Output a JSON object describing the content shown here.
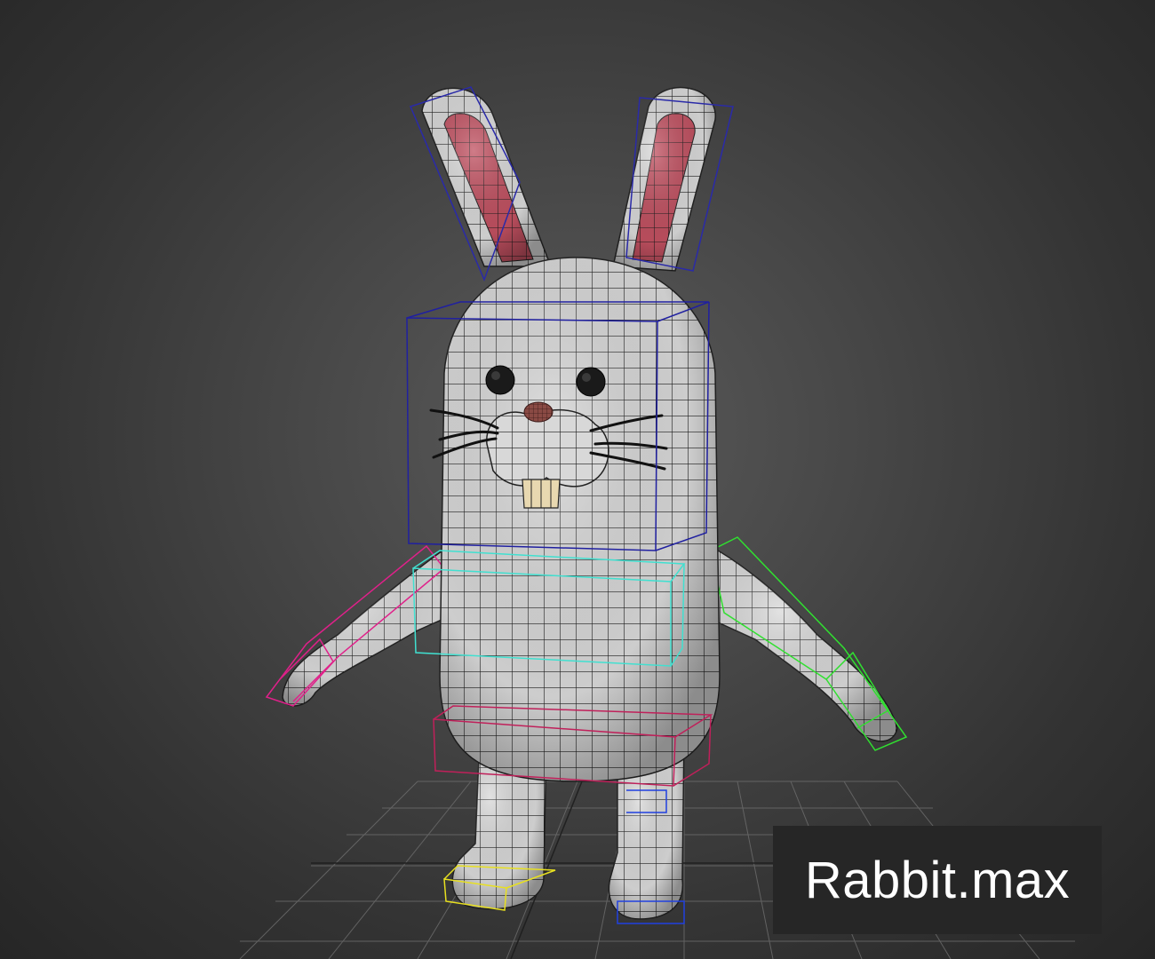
{
  "viewport": {
    "file_label": "Rabbit.max",
    "colors": {
      "background": "#474747",
      "label_background": "#262626",
      "label_text": "#ffffff",
      "mesh_fill": "#dcdcdc",
      "mesh_wire": "#1a1a1a",
      "inner_ear": "#c05060",
      "nose": "#8a4a44",
      "head_bone": "#2020a0",
      "spine_bone": "#40e0d0",
      "left_arm_bone": "#e0208a",
      "right_arm_bone": "#30e030",
      "pelvis_bone": "#c0205a",
      "left_foot_bone": "#e8e020",
      "right_foot_bone": "#2040e0",
      "grid": "#6e6e6e"
    }
  }
}
